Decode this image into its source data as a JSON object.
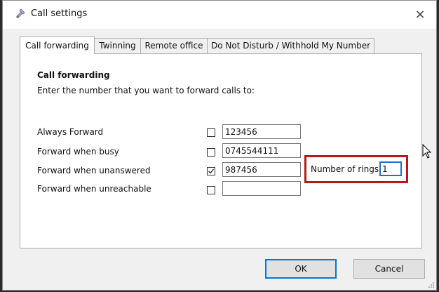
{
  "window": {
    "title": "Call settings",
    "icon": "satellite-icon",
    "close_label": "×"
  },
  "tabs": [
    {
      "label": "Call forwarding",
      "active": true
    },
    {
      "label": "Twinning",
      "active": false
    },
    {
      "label": "Remote office",
      "active": false
    },
    {
      "label": "Do Not Disturb / Withhold My Number",
      "active": false
    }
  ],
  "panel": {
    "section_title": "Call forwarding",
    "instruction": "Enter the number that you want to forward calls to:",
    "rows": [
      {
        "label": "Always Forward",
        "checked": false,
        "value": "123456"
      },
      {
        "label": "Forward when busy",
        "checked": false,
        "value": "0745544111"
      },
      {
        "label": "Forward when unanswered",
        "checked": true,
        "value": "987456"
      },
      {
        "label": "Forward when unreachable",
        "checked": false,
        "value": ""
      }
    ],
    "rings": {
      "label": "Number of rings",
      "value": "1",
      "highlight_color": "#b01c1c"
    }
  },
  "buttons": {
    "ok": "OK",
    "cancel": "Cancel"
  }
}
